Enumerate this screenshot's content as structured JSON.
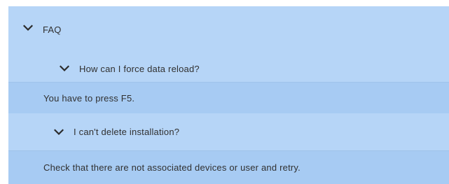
{
  "faq": {
    "title": "FAQ",
    "items": [
      {
        "question": "How can I force data reload?",
        "answer": "You have to press F5."
      },
      {
        "question": "I can't delete installation?",
        "answer": "Check that there are not associated devices or user and retry."
      }
    ]
  },
  "icons": {
    "expand": "chevron-down-icon"
  },
  "colors": {
    "header_bg": "#b6d5f7",
    "answer_bg": "#a7cbf3",
    "text": "#303030"
  }
}
